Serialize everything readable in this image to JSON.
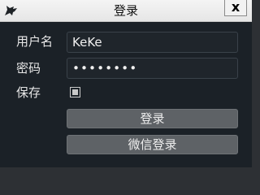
{
  "window": {
    "title": "登录",
    "close_label": "x",
    "app_icon": "wolf-icon"
  },
  "form": {
    "username_label": "用户名",
    "username_value": "KeKe",
    "password_label": "密码",
    "password_value": "12345678",
    "save_label": "保存",
    "save_checked": true,
    "login_button": "登录",
    "wechat_login_button": "微信登录"
  },
  "colors": {
    "background": "#1b2127",
    "button": "#5e6266",
    "field_border": "#3a424a"
  }
}
